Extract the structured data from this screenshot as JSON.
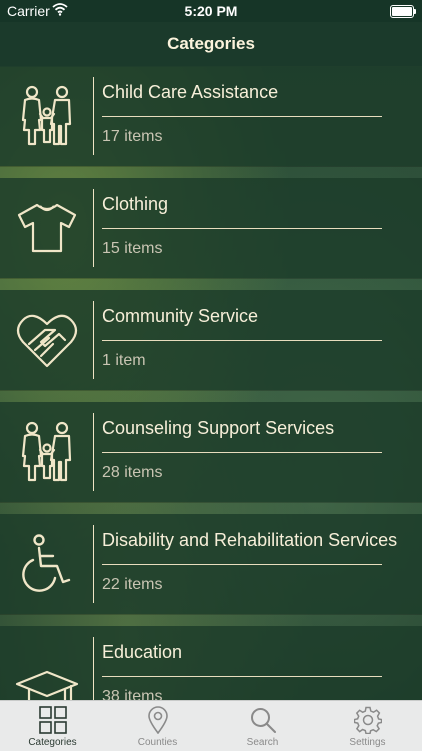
{
  "status": {
    "carrier": "Carrier",
    "time": "5:20 PM"
  },
  "header": {
    "title": "Categories"
  },
  "categories": [
    {
      "title": "Child Care Assistance",
      "count": "17 items",
      "icon": "family-icon"
    },
    {
      "title": "Clothing",
      "count": "15 items",
      "icon": "tshirt-icon"
    },
    {
      "title": "Community Service",
      "count": "1 item",
      "icon": "heart-handshake-icon"
    },
    {
      "title": "Counseling Support Services",
      "count": "28 items",
      "icon": "family-icon"
    },
    {
      "title": "Disability and Rehabilitation Services",
      "count": "22 items",
      "icon": "wheelchair-icon"
    },
    {
      "title": "Education",
      "count": "38 items",
      "icon": "graduation-cap-icon"
    }
  ],
  "tabs": [
    {
      "label": "Categories",
      "icon": "grid-icon"
    },
    {
      "label": "Counties",
      "icon": "map-pin-icon"
    },
    {
      "label": "Search",
      "icon": "search-icon"
    },
    {
      "label": "Settings",
      "icon": "gear-icon"
    }
  ],
  "colors": {
    "accent": "#f7efd9",
    "row_background": "#1c3c2a",
    "tab_bar": "#e9eaea"
  }
}
